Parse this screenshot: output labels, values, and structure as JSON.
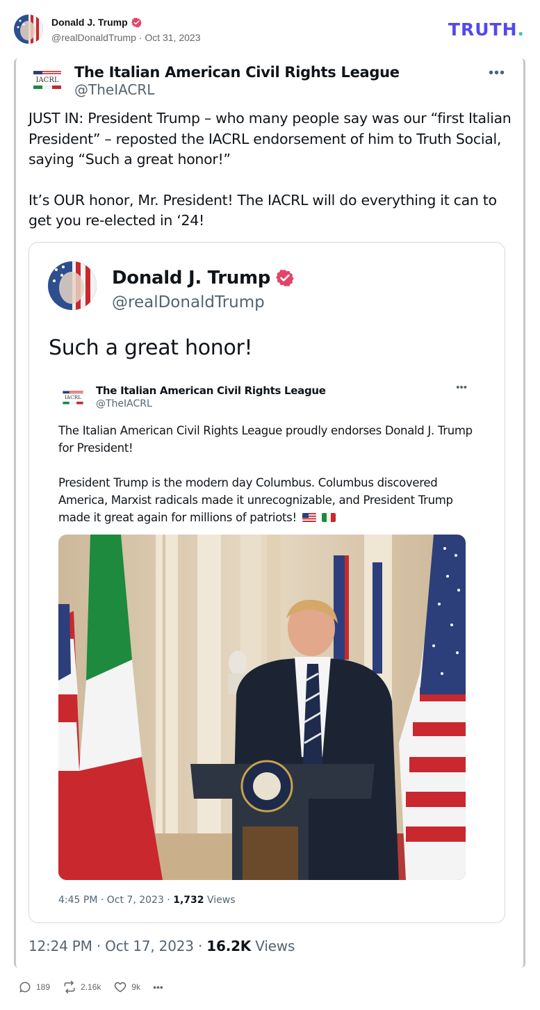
{
  "post": {
    "author": "Donald J. Trump",
    "handle": "@realDonaldTrump",
    "date": "Oct 31, 2023",
    "logo_text": "TRUTH",
    "logo_dot": "."
  },
  "tweet": {
    "logo_text": "IACRL",
    "name": "The Italian American Civil Rights League",
    "handle": "@TheIACRL",
    "more": "•••",
    "paragraphs": [
      "JUST IN: President Trump – who many people say was our “first Italian President” – reposted the IACRL endorsement of him to Truth Social, saying “Such a great honor!”",
      "It’s OUR honor, Mr. President!  The IACRL will do everything it can to get you re-elected in ‘24!"
    ],
    "footer_time": "12:24 PM · Oct 17, 2023 · ",
    "footer_views_count": "16.2K",
    "footer_views_label": " Views"
  },
  "quote": {
    "name": "Donald J. Trump",
    "handle": "@realDonaldTrump",
    "text": "Such a great honor!"
  },
  "inner": {
    "name": "The Italian American Civil Rights League",
    "handle": "@TheIACRL",
    "more": "•••",
    "para1": "The Italian American Civil Rights League proudly endorses Donald J. Trump for President!",
    "para2": "President Trump is the modern day Columbus. Columbus discovered America, Marxist radicals made it unrecognizable, and President Trump made it great again for millions of patriots!",
    "footer_time": "4:45 PM · Oct 7, 2023 · ",
    "footer_views_count": "1,732",
    "footer_views_label": " Views"
  },
  "actions": {
    "replies": "189",
    "retruths": "2.16k",
    "likes": "9k",
    "more": "•••"
  },
  "colors": {
    "truth_brand": "#5448ee",
    "verified": "#e0456b",
    "muted": "#536471"
  }
}
